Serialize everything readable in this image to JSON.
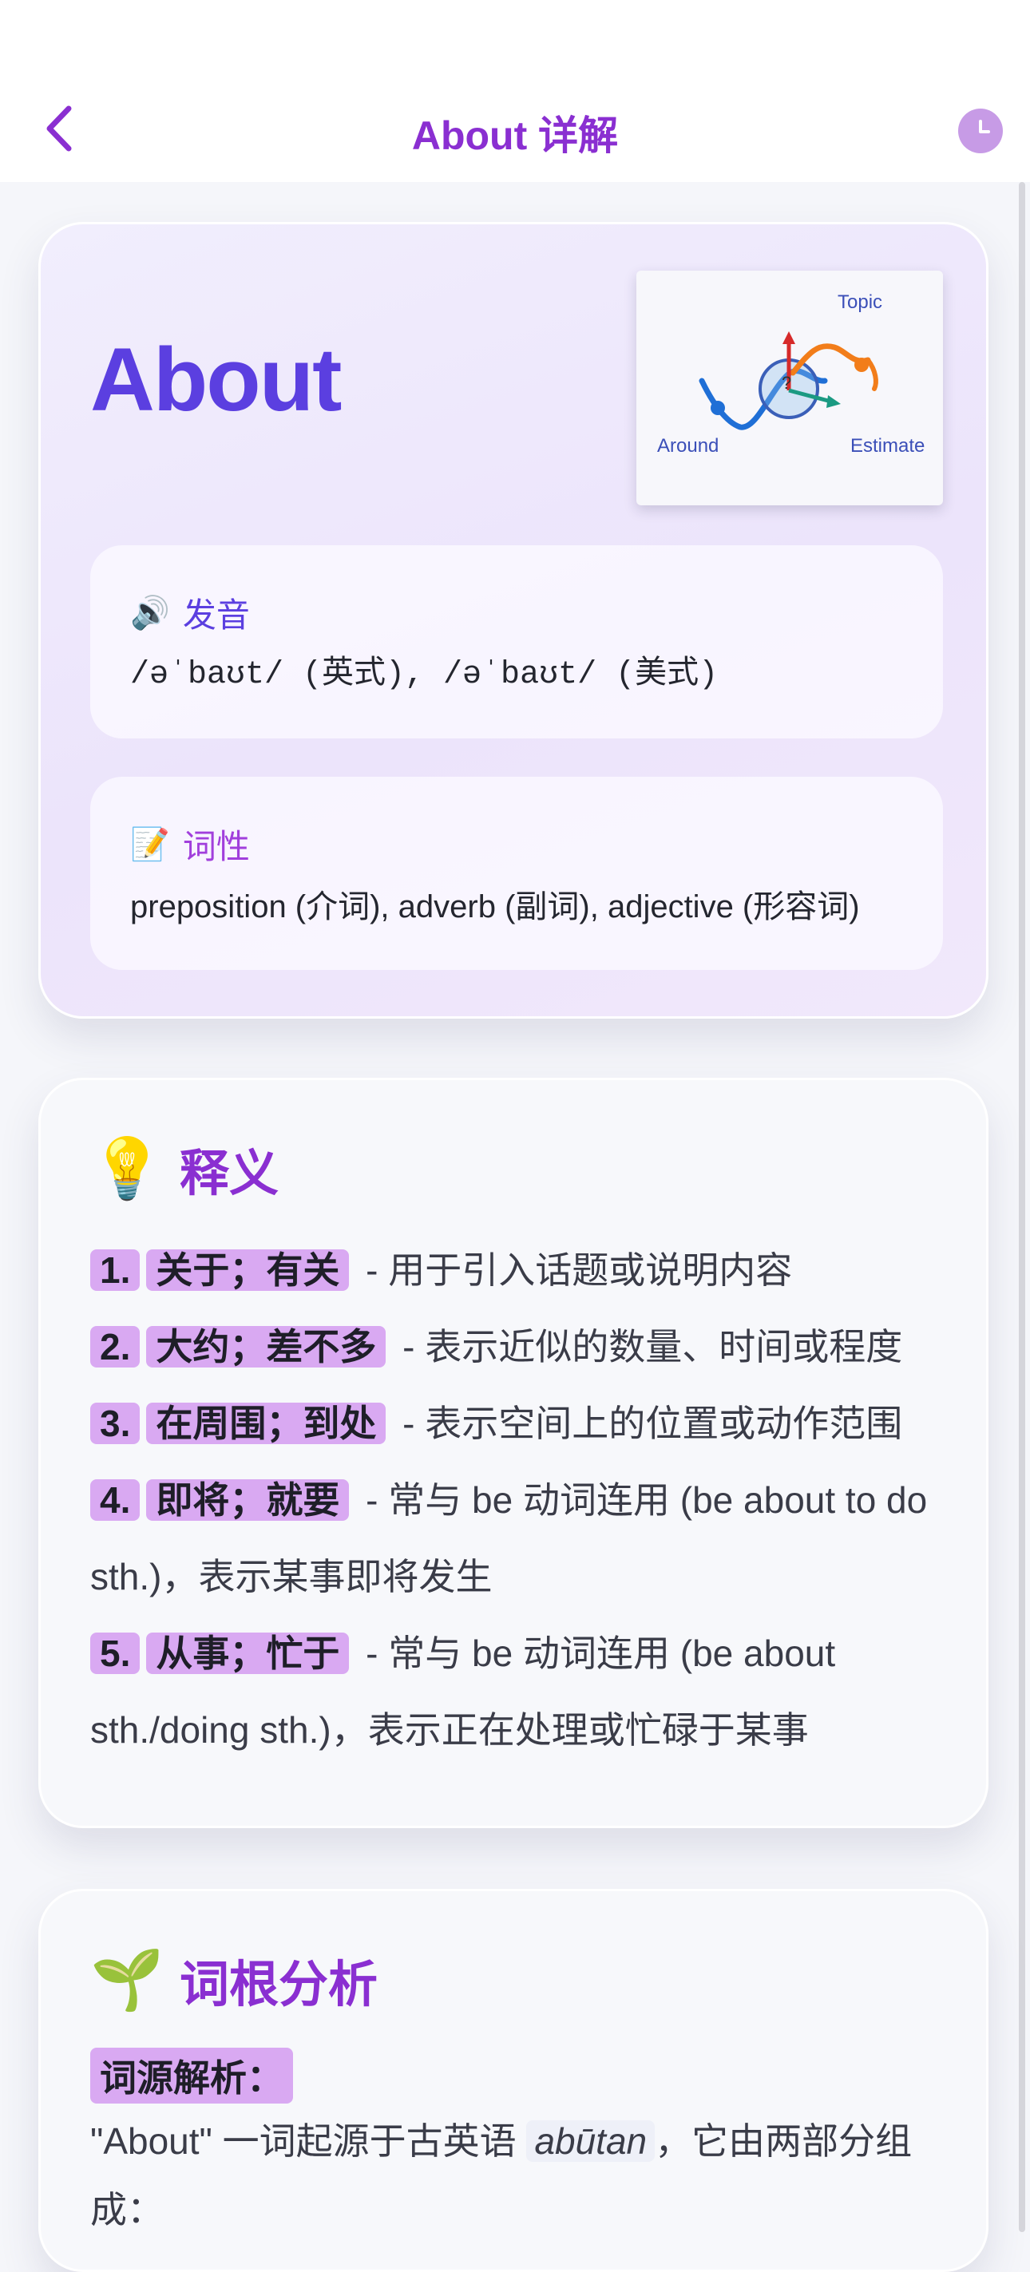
{
  "header": {
    "back_icon": "chevron-left-icon",
    "title": "About 详解",
    "history_icon": "clock-icon"
  },
  "word_card": {
    "word": "About",
    "illustration": {
      "labels": {
        "top": "Topic",
        "left": "Around",
        "right": "Estimate"
      },
      "colors": {
        "blue": "#1f6fd6",
        "orange": "#f27d1a",
        "red": "#d62a2a",
        "teal": "#1b9a82"
      }
    },
    "pronunciation": {
      "icon": "🔊",
      "label": "发音",
      "text": "/əˈbaʊt/ (英式), /əˈbaʊt/ (美式)"
    },
    "part_of_speech": {
      "icon": "📝",
      "label": "词性",
      "text": "preposition (介词), adverb (副词), adjective (形容词)"
    }
  },
  "definitions": {
    "icon": "💡",
    "title": "释义",
    "items": [
      {
        "num": "1.",
        "term": "关于；有关",
        "desc": " - 用于引入话题或说明内容"
      },
      {
        "num": "2.",
        "term": "大约；差不多",
        "desc": " - 表示近似的数量、时间或程度"
      },
      {
        "num": "3.",
        "term": "在周围；到处",
        "desc": " - 表示空间上的位置或动作范围"
      },
      {
        "num": "4.",
        "term": "即将；就要",
        "desc": " - 常与 be 动词连用 (be about to do sth.)，表示某事即将发生"
      },
      {
        "num": "5.",
        "term": "从事；忙于",
        "desc": " - 常与 be 动词连用 (be about sth./doing sth.)，表示正在处理或忙碌于某事"
      }
    ]
  },
  "root_analysis": {
    "icon": "🌱",
    "title": "词根分析",
    "subtitle": "词源解析：",
    "body_before": "\"About\" 一词起源于古英语 ",
    "body_term": "abūtan",
    "body_after": "，它由两部分组成："
  },
  "colors": {
    "accent_purple": "#8a2fd1",
    "word_indigo": "#5b3fe0",
    "highlight": "#d9a9f2"
  }
}
